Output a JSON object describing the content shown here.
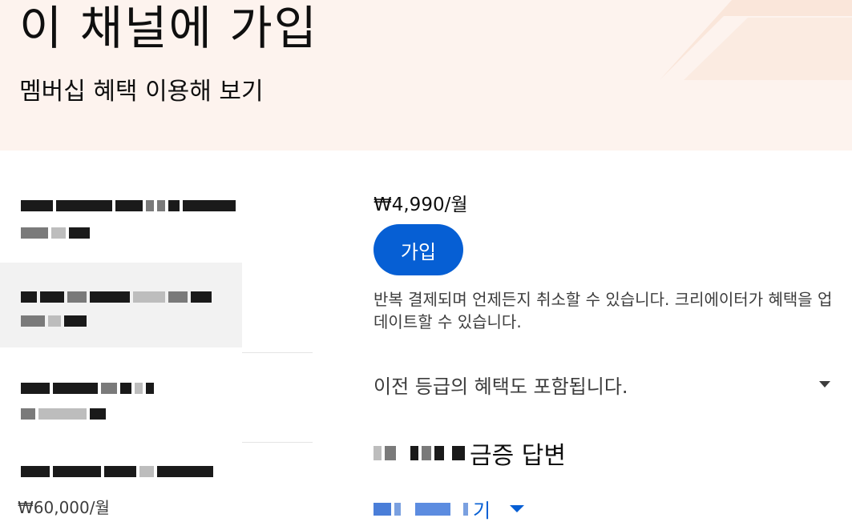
{
  "header": {
    "title": "이 채널에 가입",
    "subtitle": "멤버십 혜택 이용해 보기"
  },
  "tiers": {
    "last_tier_price": "₩60,000/월"
  },
  "detail": {
    "price": "₩4,990/월",
    "join_label": "가입",
    "note": "반복 결제되며 언제든지 취소할 수 있습니다. 크리에이터가 혜택을 업데이트할 수 있습니다.",
    "previous_perks": "이전 등급의 혜택도 포함됩니다.",
    "benefit_suffix": "금증 답변",
    "more_suffix": "기"
  },
  "colors": {
    "banner_bg": "#fdf3ee",
    "accent": "#065fd4",
    "selected_bg": "#f2f2f2"
  }
}
